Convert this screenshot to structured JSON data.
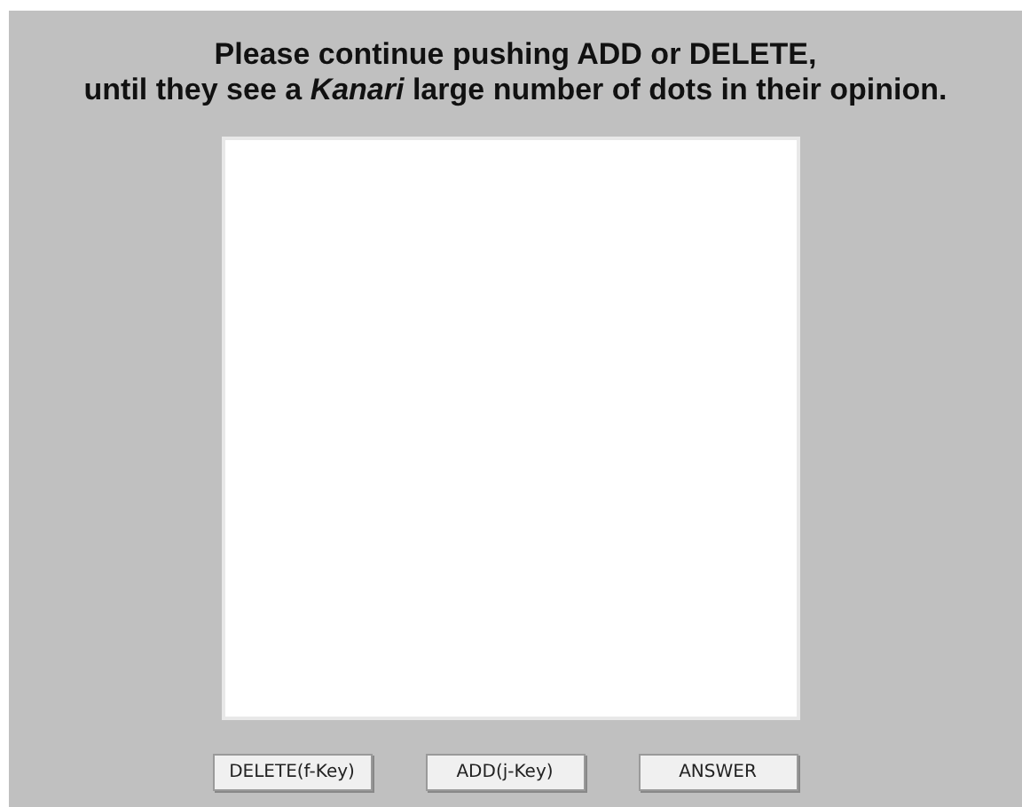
{
  "instruction": [
    "Please continue pushing ADD or DELETE,",
    "until they see a *Kanari* large number of dots in their opinion."
  ],
  "buttons": [
    "DELETE(f-Key)",
    "ADD(j-Key)",
    "ANSWER"
  ]
}
